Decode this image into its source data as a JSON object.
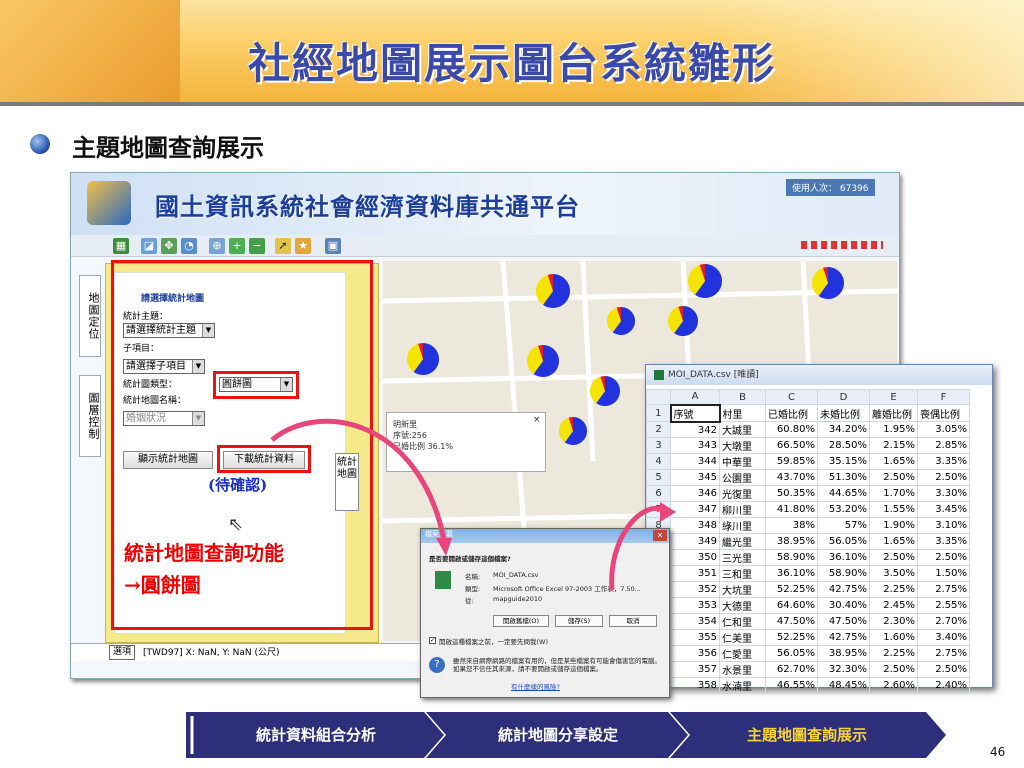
{
  "slide": {
    "title": "社經地圖展示圖台系統雛形",
    "subtitle": "主題地圖查詢展示",
    "page_number": "46",
    "pending_note": "(待確認)",
    "annotation_line1": "統計地圖查詢功能",
    "annotation_line2": "→圓餅圖"
  },
  "app": {
    "title": "國土資訊系統社會經濟資料庫共通平台",
    "visitor_count": "使用人次： 67396",
    "sidetabs": [
      "地圖定位",
      "圖層控制"
    ],
    "map_side_label": "統計地圖",
    "panel": {
      "header": "請選擇統計地圖",
      "theme_label": "統計主題：",
      "theme_value": "請選擇統計主題",
      "subitem_label": "子項目：",
      "subitem_value": "請選擇子項目",
      "chart_type_label": "統計圖類型：",
      "chart_type_value": "圓餅圖",
      "map_name_label": "統計地圖名稱：",
      "map_name_value": "婚姻狀況",
      "show_button": "顯示統計地圖",
      "download_button": "下載統計資料"
    },
    "popup": {
      "line1": "明新里",
      "line2": "序號:256",
      "line3": "已婚比例 36.1%"
    },
    "status": {
      "tab": "選項",
      "coords": "[TWD97] X: NaN, Y: NaN (公尺)"
    }
  },
  "download_dialog": {
    "title": "檔案下載",
    "question": "是否要開啟或儲存這個檔案?",
    "name_label": "名稱:",
    "name_value": "MOI_DATA.csv",
    "type_label": "類型:",
    "type_value": "Microsoft Office Excel 97-2003 工作表，7.50...",
    "from_label": "從:",
    "from_value": "mapguide2010",
    "open_button": "開啟舊檔(O)",
    "save_button": "儲存(S)",
    "cancel_button": "取消",
    "checkbox_label": "開啟這種檔案之前，一定要先問我(W)",
    "warning": "雖然來自網際網路的檔案有用的，但是某些檔案有可能會傷害您的電腦。如果您不信任其來源，請不要開啟或儲存這個檔案。",
    "warning_link": "有什麼樣的風險?"
  },
  "excel": {
    "title": "MOI_DATA.csv [唯讀]",
    "columns": [
      "A",
      "B",
      "C",
      "D",
      "E",
      "F"
    ],
    "header": [
      "序號",
      "村里",
      "已婚比例",
      "未婚比例",
      "離婚比例",
      "喪偶比例"
    ],
    "rows": [
      [
        "342",
        "大誠里",
        "60.80%",
        "34.20%",
        "1.95%",
        "3.05%"
      ],
      [
        "343",
        "大墩里",
        "66.50%",
        "28.50%",
        "2.15%",
        "2.85%"
      ],
      [
        "344",
        "中華里",
        "59.85%",
        "35.15%",
        "1.65%",
        "3.35%"
      ],
      [
        "345",
        "公園里",
        "43.70%",
        "51.30%",
        "2.50%",
        "2.50%"
      ],
      [
        "346",
        "光復里",
        "50.35%",
        "44.65%",
        "1.70%",
        "3.30%"
      ],
      [
        "347",
        "柳川里",
        "41.80%",
        "53.20%",
        "1.55%",
        "3.45%"
      ],
      [
        "348",
        "綠川里",
        "38%",
        "57%",
        "1.90%",
        "3.10%"
      ],
      [
        "349",
        "繼光里",
        "38.95%",
        "56.05%",
        "1.65%",
        "3.35%"
      ],
      [
        "350",
        "三光里",
        "58.90%",
        "36.10%",
        "2.50%",
        "2.50%"
      ],
      [
        "351",
        "三和里",
        "36.10%",
        "58.90%",
        "3.50%",
        "1.50%"
      ],
      [
        "352",
        "大坑里",
        "52.25%",
        "42.75%",
        "2.25%",
        "2.75%"
      ],
      [
        "353",
        "大德里",
        "64.60%",
        "30.40%",
        "2.45%",
        "2.55%"
      ],
      [
        "354",
        "仁和里",
        "47.50%",
        "47.50%",
        "2.30%",
        "2.70%"
      ],
      [
        "355",
        "仁美里",
        "52.25%",
        "42.75%",
        "1.60%",
        "3.40%"
      ],
      [
        "356",
        "仁愛里",
        "56.05%",
        "38.95%",
        "2.25%",
        "2.75%"
      ],
      [
        "357",
        "水景里",
        "62.70%",
        "32.30%",
        "2.50%",
        "2.50%"
      ],
      [
        "358",
        "水湳里",
        "46.55%",
        "48.45%",
        "2.60%",
        "2.40%"
      ]
    ]
  },
  "flow_steps": [
    "統計資料組合分析",
    "統計地圖分享設定",
    "主題地圖查詢展示"
  ],
  "colors": {
    "title": "#3b4aa8",
    "annotation": "#e00000",
    "pie_blue": "#2233dd",
    "pie_yellow": "#f5e400",
    "pie_red": "#e02020",
    "active_step": "#f7d23a"
  }
}
